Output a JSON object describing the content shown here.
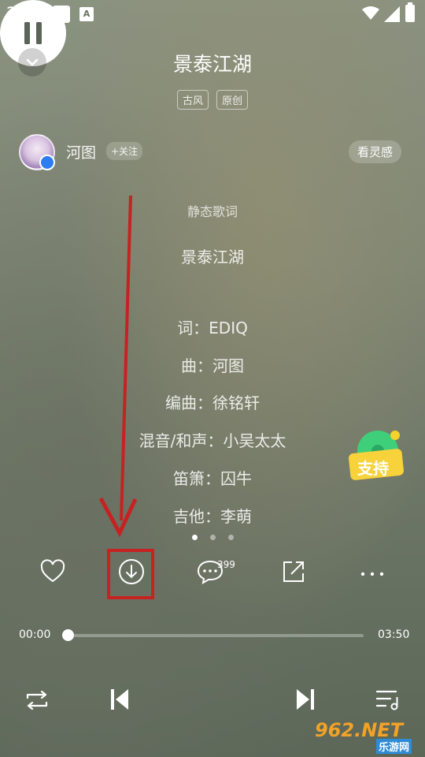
{
  "status_bar": {
    "time": "2:14",
    "a_icon": "A"
  },
  "song": {
    "title": "景泰江湖",
    "tags": [
      "古风",
      "原创"
    ]
  },
  "artist": {
    "name": "河图",
    "follow_label": "+关注"
  },
  "inspiration_label": "看灵感",
  "lyrics": {
    "header": "静态歌词",
    "lines": [
      "景泰江湖",
      "",
      "词：EDIQ",
      "曲：河图",
      "编曲：徐铭轩",
      "混音/和声：小吴太太",
      "笛箫：囚牛",
      "吉他：李萌"
    ]
  },
  "support_badge": "支持",
  "pager": {
    "count": 3,
    "active": 0
  },
  "actions": {
    "comment_count": "399"
  },
  "playback": {
    "current": "00:00",
    "total": "03:50",
    "progress": 0.0
  },
  "watermark": {
    "main": "962.NET",
    "sub": "乐游网"
  },
  "colors": {
    "highlight": "#c62222",
    "accent_blue": "#2d7df0"
  }
}
